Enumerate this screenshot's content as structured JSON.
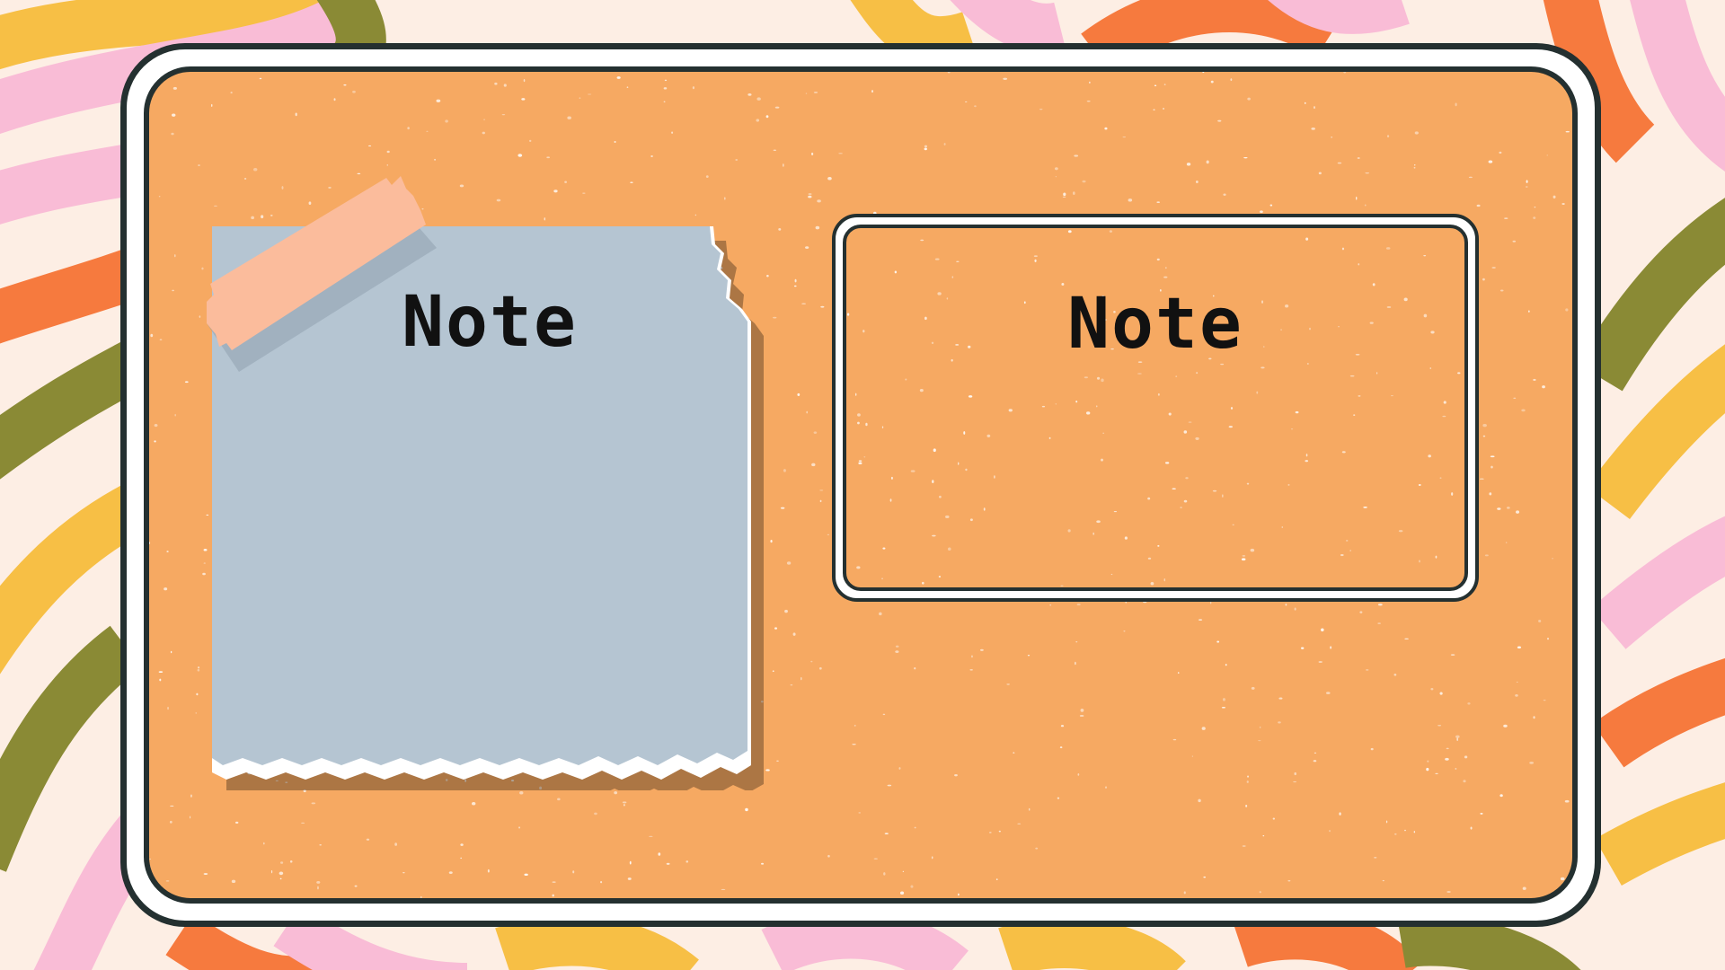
{
  "colors": {
    "background_cream": "#fdeee4",
    "stripe_pink": "#f9bcd6",
    "stripe_orange": "#f67a3e",
    "stripe_olive": "#8a8a35",
    "stripe_yellow": "#f7bf45",
    "card_orange": "#f6a962",
    "frame_dark": "#243030",
    "paper_blue": "#b5c5d2",
    "tape_peach": "#fbbc9c",
    "text": "#111111"
  },
  "notes": {
    "paper": {
      "title": "Note"
    },
    "box": {
      "title": "Note"
    }
  }
}
